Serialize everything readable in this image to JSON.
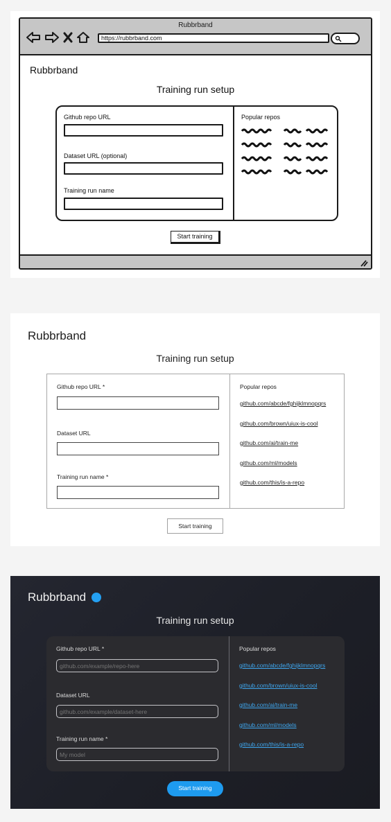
{
  "sketch": {
    "window_title": "Rubbrband",
    "url": "https://rubbrband.com",
    "brand": "Rubbrband",
    "page_title": "Training run setup",
    "fields": [
      {
        "label": "Github repo URL"
      },
      {
        "label": "Dataset URL (optional)"
      },
      {
        "label": "Training run name"
      }
    ],
    "popular_title": "Popular repos",
    "button": "Start training",
    "icons": [
      "back-arrow-icon",
      "forward-arrow-icon",
      "close-x-icon",
      "home-icon",
      "search-icon",
      "resize-grip-icon"
    ]
  },
  "light": {
    "brand": "Rubbrband",
    "page_title": "Training run setup",
    "fields": [
      {
        "label": "Github repo URL *"
      },
      {
        "label": "Dataset URL"
      },
      {
        "label": "Training run name *"
      }
    ],
    "popular_title": "Popular repos",
    "repos": [
      "github.com/abcde/fghijklmnopqrs",
      "github.com/brown/uiux-is-cool",
      "github.com/ai/train-me",
      "github.com/ml/models",
      "github.com/this/is-a-repo"
    ],
    "button": "Start training"
  },
  "dark": {
    "brand": "Rubbrband",
    "page_title": "Training run setup",
    "fields": [
      {
        "label": "Github repo URL *",
        "placeholder": "github.com/example/repo-here"
      },
      {
        "label": "Dataset URL",
        "placeholder": "github.com/example/dataset-here"
      },
      {
        "label": "Training run name *",
        "placeholder": "My model"
      }
    ],
    "popular_title": "Popular repos",
    "repos": [
      "github.com/abcde/fghijklmnopqrs",
      "github.com/brown/uiux-is-cool",
      "github.com/ai/train-me",
      "github.com/ml/models",
      "github.com/this/is-a-repo"
    ],
    "button": "Start training",
    "colors": {
      "background": "#1d1f27",
      "card": "#2b2b2f",
      "accent": "#1e9bef",
      "link": "#3ea6ee"
    }
  }
}
